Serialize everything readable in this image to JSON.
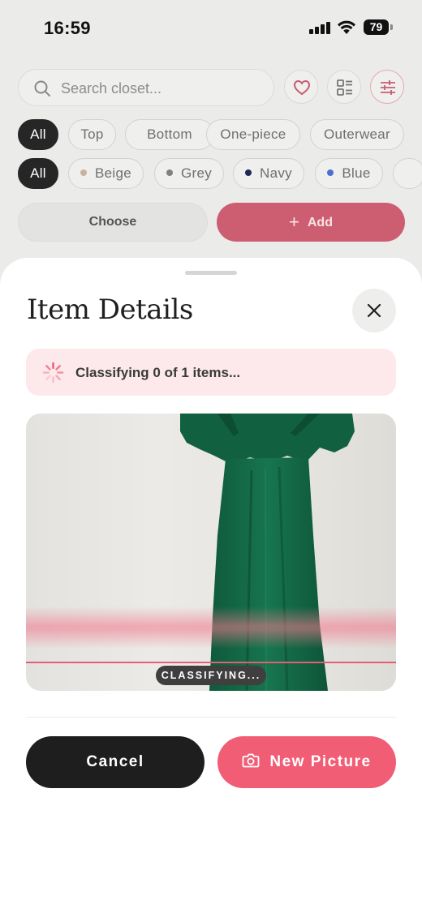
{
  "status_bar": {
    "time": "16:59",
    "battery": "79"
  },
  "background": {
    "search_placeholder": "Search closet...",
    "category_chips": [
      {
        "label": "All",
        "active": true
      },
      {
        "label": "Top",
        "active": false
      },
      {
        "label": "Bottom",
        "active": false
      },
      {
        "label": "One-piece",
        "active": false
      },
      {
        "label": "Outerwear",
        "active": false
      }
    ],
    "color_chips": [
      {
        "label": "All",
        "active": true
      },
      {
        "label": "Beige",
        "color": "#c8b29c"
      },
      {
        "label": "Grey",
        "color": "#808080"
      },
      {
        "label": "Navy",
        "color": "#1d2a56"
      },
      {
        "label": "Blue",
        "color": "#4a6fd0"
      }
    ],
    "choose_label": "Choose",
    "add_label": "Add"
  },
  "sheet": {
    "title": "Item Details",
    "progress_text": "Classifying 0 of 1 items...",
    "scan_label": "CLASSIFYING...",
    "cancel_label": "Cancel",
    "new_picture_label": "New Picture"
  },
  "colors": {
    "accent": "#f05d75",
    "accent_dimmed": "#cd5e71",
    "banner_bg": "#fde9ec",
    "dark": "#1e1e1e",
    "dress_green": "#16704d"
  }
}
